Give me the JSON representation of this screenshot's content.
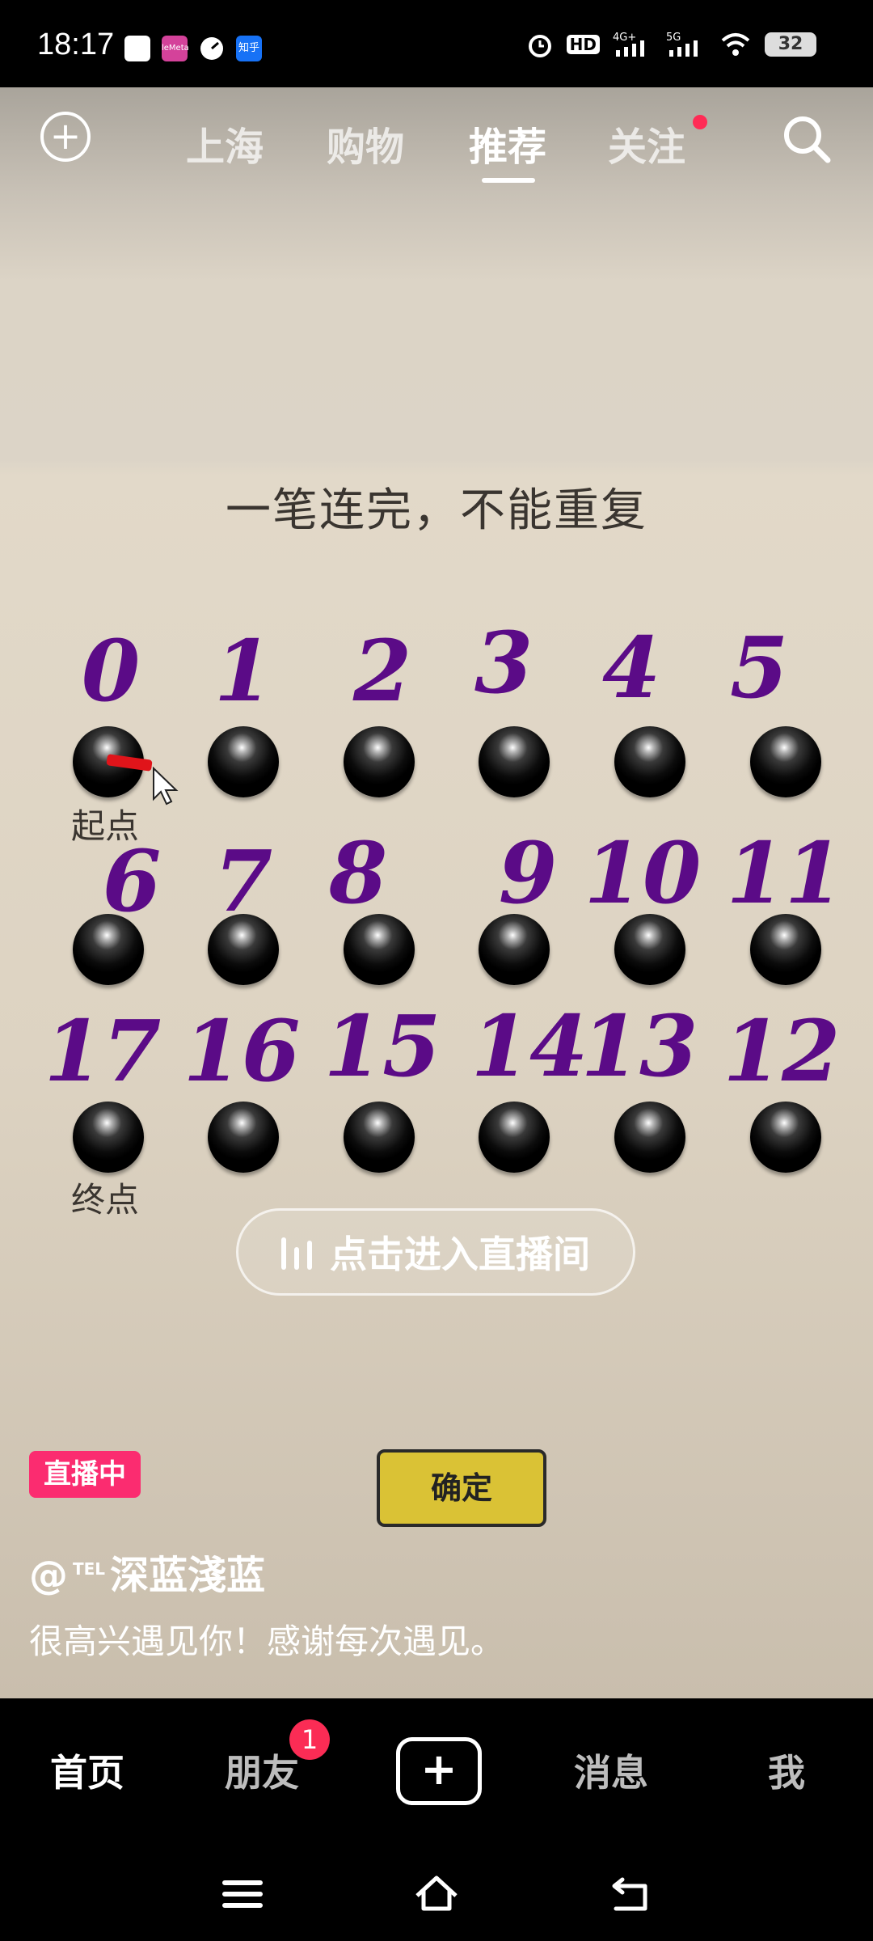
{
  "status_bar": {
    "time": "18:17",
    "app_icons": [
      {
        "name": "white-square-app-icon",
        "color": "#ffffff"
      },
      {
        "name": "lofter-app-icon",
        "color": "#d4429a",
        "label": "leMeta"
      },
      {
        "name": "speedometer-app-icon",
        "color": "#ffffff"
      },
      {
        "name": "zhihu-app-icon",
        "color": "#1772f6",
        "label": "知乎"
      }
    ],
    "battery": "32"
  },
  "top_nav": {
    "tabs": [
      {
        "label": "上海",
        "active": false
      },
      {
        "label": "购物",
        "active": false
      },
      {
        "label": "推荐",
        "active": true
      },
      {
        "label": "关注",
        "active": false,
        "has_dot": true
      }
    ]
  },
  "video": {
    "puzzle_title": "一笔连完，不能重复",
    "numbers": [
      "0",
      "1",
      "2",
      "3",
      "4",
      "5",
      "6",
      "7",
      "8",
      "9",
      "10",
      "11",
      "17",
      "16",
      "15",
      "14",
      "13",
      "12"
    ],
    "start_label": "起点",
    "end_label": "终点",
    "live_enter_label": "点击进入直播间",
    "live_badge": "直播中",
    "confirm_label": "确定",
    "author_prefix": "@",
    "author_tag": "TEL",
    "author_name": "深蓝淺蓝",
    "caption": "很高兴遇见你！感谢每次遇见。"
  },
  "bottom_tabs": {
    "home": "首页",
    "friends": "朋友",
    "friends_badge": "1",
    "create": "+",
    "messages": "消息",
    "me": "我"
  }
}
